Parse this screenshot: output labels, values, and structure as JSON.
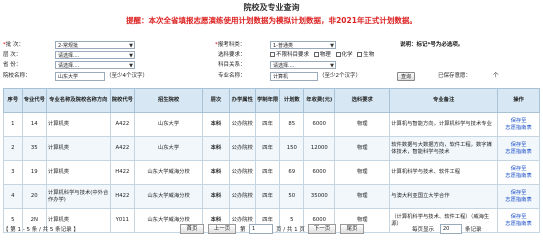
{
  "page": {
    "title": "院校及专业查询",
    "notice_parts": [
      "提醒：本次全省填报志愿演练使用计划数据为模拟计划数据，非",
      "2021",
      "年正式计划数据。"
    ]
  },
  "form": {
    "batch_label": "批    次：",
    "batch_value": "2-常规批",
    "category_label": "层    次：",
    "category_value": "请选择....",
    "province_label": "省    份：",
    "province_value": "请选择....",
    "school_label": "院校名称：",
    "school_value": "山东大学",
    "school_hint": "（至少4个汉字）",
    "ptype_label": "报考科类：",
    "ptype_value": "1-普通类",
    "subject_req_label": "选科要求：",
    "subject_options": [
      "不限科目要求",
      "物理",
      "化学",
      "生物"
    ],
    "major_type_label": "科目关系：",
    "major_type_value": "请选择....",
    "major_label": "专业名称：",
    "major_value": "计算机",
    "major_hint": "（至少2个汉字）",
    "query_button": "查询",
    "note": "说明：标记*号为必选项。",
    "selected_count_label": "已保存意愿：",
    "selected_count_suffix": "个"
  },
  "table": {
    "headers": [
      "序号",
      "专业代号",
      "专业名称及院校名称方向",
      "院校代号",
      "招生院校",
      "层次",
      "办学属性",
      "学制年限",
      "计划数",
      "年收费(元)",
      "选科要求",
      "专业备注",
      "操作"
    ],
    "rows": [
      {
        "no": "1",
        "code": "14",
        "name": "计算机类",
        "scode": "A422",
        "school": "山东大学",
        "level": "本科",
        "prop": "公办院校",
        "years": "四年",
        "plan": "85",
        "fee": "6000",
        "req": "物理",
        "remark": "计算机与智能方向，计算机科学与技术专业",
        "op1": "保存至",
        "op2": "志愿指南表"
      },
      {
        "no": "2",
        "code": "35",
        "name": "计算机类",
        "scode": "A422",
        "school": "山东大学",
        "level": "本科",
        "prop": "公办院校",
        "years": "四年",
        "plan": "150",
        "fee": "12000",
        "req": "物理",
        "remark": "软件数据与大数据方向，软件工程，数字媒体技术，智能科学与技术",
        "op1": "保存至",
        "op2": "志愿指南表"
      },
      {
        "no": "3",
        "code": "19",
        "name": "计算机类",
        "scode": "H422",
        "school": "山东大学威海分校",
        "level": "本科",
        "prop": "公办院校",
        "years": "四年",
        "plan": "69",
        "fee": "6000",
        "req": "物理",
        "remark": "计算机科学与技术、软件工程",
        "op1": "保存至",
        "op2": "志愿指南表"
      },
      {
        "no": "4",
        "code": "20",
        "name": "计算机科学与技术(中外合作办学)",
        "scode": "H422",
        "school": "山东大学威海分校",
        "level": "本科",
        "prop": "公办院校",
        "years": "四年",
        "plan": "50",
        "fee": "35000",
        "req": "物理",
        "remark": "与澳大利亚国立大学合作",
        "op1": "保存至",
        "op2": "志愿指南表"
      },
      {
        "no": "5",
        "code": "2N",
        "name": "计算机类",
        "scode": "Y011",
        "school": "山东大学威海分校",
        "level": "本科",
        "prop": "公办院校",
        "years": "四年",
        "plan": "5",
        "fee": "6000",
        "req": "物理",
        "remark": "（计算机科学与技术、软件工程）（威海生源）",
        "op1": "保存至",
        "op2": "志愿指南表"
      }
    ]
  },
  "pager": {
    "summary": "【 第 1 - 5 条 / 共 5 条记录 】",
    "first": "首页",
    "prev": "上一页",
    "page_prefix": "第",
    "page_value": "1",
    "page_suffix": "页 / 共 1 页",
    "next": "下一页",
    "last": "尾页",
    "per_page_label": "每页显示",
    "per_page_value": "20",
    "per_page_suffix": "条记录"
  },
  "colors": {
    "notice": "#dd2222",
    "header_bg": "#d7e8f4",
    "link": "#1a4fc8"
  }
}
